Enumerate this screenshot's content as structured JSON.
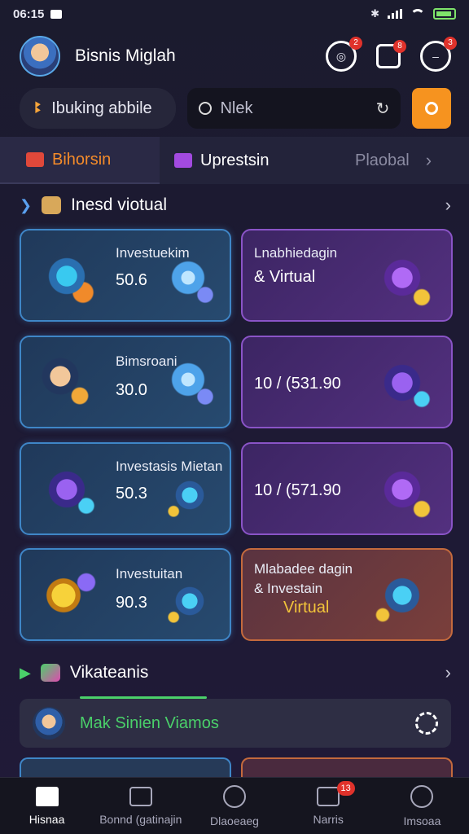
{
  "status": {
    "time": "06:15"
  },
  "header": {
    "username": "Bisnis Miglah",
    "badges": [
      "2",
      "8",
      "3"
    ]
  },
  "chip": {
    "label": "Ibuking abbile"
  },
  "search": {
    "value": "Nlek"
  },
  "tabs": [
    {
      "label": "Bihorsin"
    },
    {
      "label": "Uprestsin"
    },
    {
      "label": "Plaobal"
    }
  ],
  "section1": {
    "title": "Inesd viotual"
  },
  "cards": [
    {
      "line1": "Investuekim",
      "line2": "50.6",
      "style": "blue",
      "icon": "investment-icon"
    },
    {
      "line1": "Lnabhiedagin",
      "line2": "& Virtual",
      "style": "purple",
      "icon": "server-icon"
    },
    {
      "line1": "Bimsroani",
      "line2": "30.0",
      "style": "blue",
      "icon": "pilot-icon"
    },
    {
      "line1": "",
      "line2": "10 / (531.90",
      "style": "purple",
      "icon": "cube-icon"
    },
    {
      "line1": "Investasis Mietan",
      "line2": "50.3",
      "style": "blue",
      "icon": "crypto-icon"
    },
    {
      "line1": "",
      "line2": "10 / (571.90",
      "style": "purple",
      "icon": "vault-icon"
    },
    {
      "line1": "Investuitan",
      "line2": "90.3",
      "style": "blue",
      "icon": "coin-icon"
    },
    {
      "line1": "Mlabadee dagin",
      "line2": "& Investain",
      "line3": "Virtual",
      "style": "orange",
      "icon": "screen-icon"
    }
  ],
  "section2": {
    "title": "Vikateanis"
  },
  "list_item": {
    "text": "Mak Sinien Viamos"
  },
  "nav": [
    {
      "label": "Hisnaa"
    },
    {
      "label": "Bonnd (gatinajin"
    },
    {
      "label": "Dlaoeaeg"
    },
    {
      "label": "Narris",
      "badge": "13"
    },
    {
      "label": "Imsoaa"
    }
  ],
  "colors": {
    "accent": "#f6931f",
    "green": "#4ad06a",
    "blue_card": "#3f86c7",
    "purple_card": "#8a54c7"
  }
}
